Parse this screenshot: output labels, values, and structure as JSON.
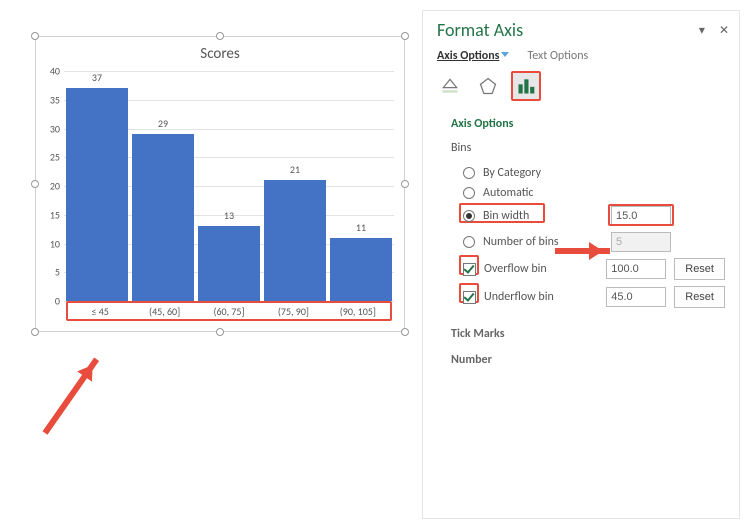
{
  "chart_data": {
    "type": "bar",
    "title": "Scores",
    "categories": [
      "≤ 45",
      "(45, 60]",
      "(60, 75]",
      "(75, 90]",
      "(90, 105]"
    ],
    "values": [
      37,
      29,
      13,
      21,
      11
    ],
    "ylim": [
      0,
      40
    ],
    "yticks": [
      0,
      5,
      10,
      15,
      20,
      25,
      30,
      35,
      40
    ],
    "xlabel": "",
    "ylabel": ""
  },
  "panel": {
    "title": "Format Axis",
    "tabs": {
      "axis_options": "Axis Options",
      "text_options": "Text Options"
    },
    "sections": {
      "axis_options": "Axis Options",
      "tick_marks": "Tick Marks",
      "number": "Number"
    },
    "bins_label": "Bins",
    "options": {
      "by_category": "By Category",
      "automatic": "Automatic",
      "bin_width": "Bin width",
      "number_of_bins": "Number of bins",
      "overflow_bin": "Overflow bin",
      "underflow_bin": "Underflow bin"
    },
    "values": {
      "bin_width": "15.0",
      "number_of_bins": "5",
      "overflow": "100.0",
      "underflow": "45.0"
    },
    "reset": "Reset"
  }
}
